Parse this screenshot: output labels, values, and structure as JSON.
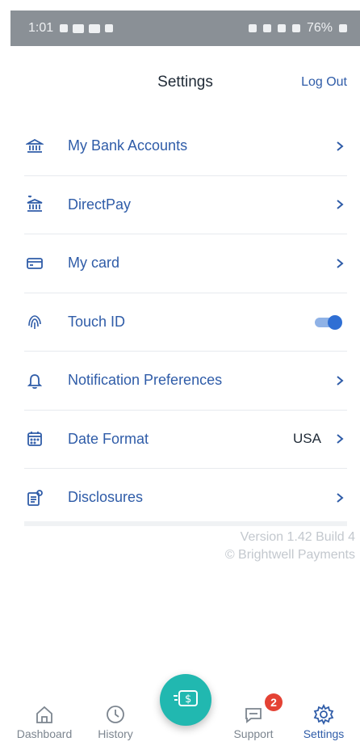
{
  "status_bar": {
    "time": "1:01",
    "battery": "76%"
  },
  "header": {
    "title": "Settings",
    "logout_label": "Log Out"
  },
  "settings_items": [
    {
      "label": "My Bank Accounts",
      "icon": "bank-icon"
    },
    {
      "label": "DirectPay",
      "icon": "bank-transfer-icon"
    },
    {
      "label": "My card",
      "icon": "card-icon"
    },
    {
      "label": "Touch ID",
      "icon": "fingerprint-icon",
      "toggle_on": true
    },
    {
      "label": "Notification Preferences",
      "icon": "bell-icon"
    },
    {
      "label": "Date Format",
      "icon": "calendar-icon",
      "value": "USA"
    },
    {
      "label": "Disclosures",
      "icon": "document-icon"
    }
  ],
  "footer": {
    "version": "Version 1.42 Build 4",
    "copyright": "© Brightwell Payments"
  },
  "bottom_nav": {
    "items": [
      {
        "label": "Dashboard",
        "icon": "home-icon"
      },
      {
        "label": "History",
        "icon": "history-icon"
      },
      {
        "label": "Support",
        "icon": "chat-icon",
        "badge": "2"
      },
      {
        "label": "Settings",
        "icon": "gear-icon",
        "active": true
      }
    ],
    "fab_icon": "send-money-icon"
  },
  "colors": {
    "accent": "#2f5ca8",
    "fab": "#21b8b0",
    "badge": "#e44234"
  }
}
